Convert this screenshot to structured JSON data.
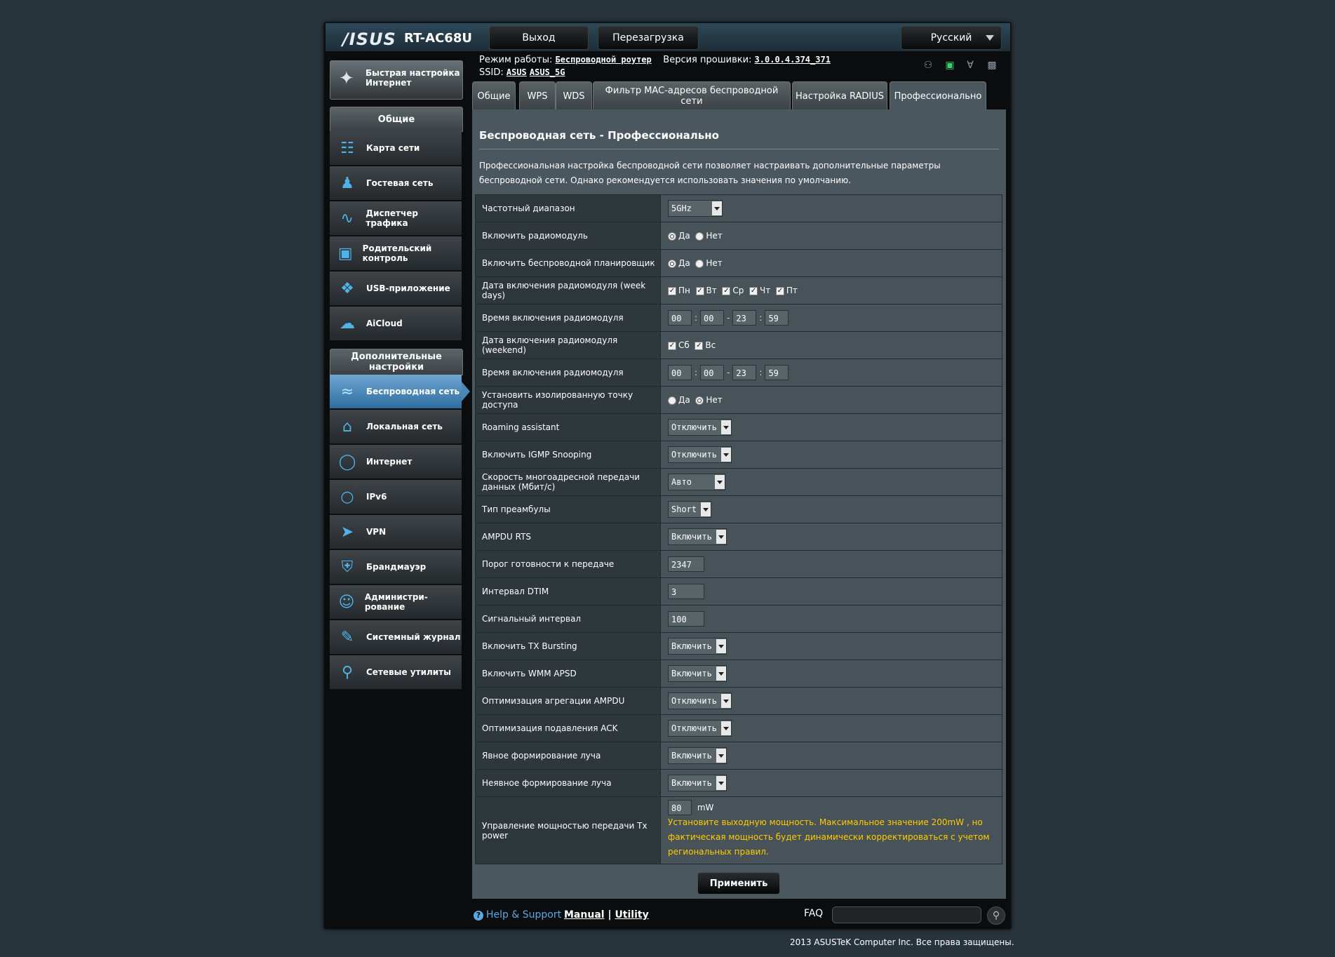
{
  "header": {
    "logo": "/ISUS",
    "model": "RT-AC68U",
    "logout": "Выход",
    "reboot": "Перезагрузка",
    "language": "Русский"
  },
  "status": {
    "mode_label": "Режим работы:",
    "mode_value": "Беспроводной роутер",
    "firmware_label": "Версия прошивки:",
    "firmware_value": "3.0.0.4.374_371",
    "ssid_label": "SSID:",
    "ssid1": "ASUS",
    "ssid2": "ASUS_5G"
  },
  "sidebar": {
    "quick_setup": "Быстрая настройка Интернет",
    "group_general": "Общие",
    "general_items": [
      {
        "label": "Карта сети",
        "icon": "network-map-icon"
      },
      {
        "label": "Гостевая сеть",
        "icon": "guest-network-icon"
      },
      {
        "label": "Диспетчер трафика",
        "icon": "traffic-manager-icon"
      },
      {
        "label": "Родительский контроль",
        "icon": "parental-control-icon"
      },
      {
        "label": "USB-приложение",
        "icon": "usb-app-icon"
      },
      {
        "label": "AiCloud",
        "icon": "aicloud-icon"
      }
    ],
    "group_advanced": "Дополнительные настройки",
    "advanced_items": [
      {
        "label": "Беспроводная сеть",
        "icon": "wireless-icon"
      },
      {
        "label": "Локальная сеть",
        "icon": "lan-icon"
      },
      {
        "label": "Интернет",
        "icon": "globe-icon"
      },
      {
        "label": "IPv6",
        "icon": "ipv6-icon"
      },
      {
        "label": "VPN",
        "icon": "vpn-icon"
      },
      {
        "label": "Брандмауэр",
        "icon": "firewall-icon"
      },
      {
        "label": "Администри-рование",
        "icon": "admin-icon"
      },
      {
        "label": "Системный журнал",
        "icon": "system-log-icon"
      },
      {
        "label": "Сетевые утилиты",
        "icon": "network-tools-icon"
      }
    ]
  },
  "tabs": [
    "Общие",
    "WPS",
    "WDS",
    "Фильтр MAC-адресов беспроводной сети",
    "Настройка RADIUS",
    "Профессионально"
  ],
  "page": {
    "title": "Беспроводная сеть - Профессионально",
    "description": "Профессиональная настройка беспроводной сети позволяет настраивать дополнительные параметры беспроводной сети. Однако рекомендуется использовать значения по умолчанию."
  },
  "labels": {
    "yes": "Да",
    "no": "Нет",
    "mon": "Пн",
    "tue": "Вт",
    "wed": "Ср",
    "thu": "Чт",
    "fri": "Пт",
    "sat": "Сб",
    "sun": "Вс",
    "mw": "mW"
  },
  "settings": {
    "band": {
      "label": "Частотный диапазон",
      "value": "5GHz"
    },
    "radio": {
      "label": "Включить радиомодуль"
    },
    "scheduler": {
      "label": "Включить беспроводной планировщик"
    },
    "weekdays": {
      "label": "Дата включения радиомодуля (week days)"
    },
    "weekday_time": {
      "label": "Время включения радиомодуля",
      "h1": "00",
      "m1": "00",
      "h2": "23",
      "m2": "59"
    },
    "weekend": {
      "label": "Дата включения радиомодуля (weekend)"
    },
    "weekend_time": {
      "label": "Время включения радиомодуля",
      "h1": "00",
      "m1": "00",
      "h2": "23",
      "m2": "59"
    },
    "isolation": {
      "label": "Установить изолированную точку доступа"
    },
    "roaming": {
      "label": "Roaming assistant",
      "value": "Отключить"
    },
    "igmp": {
      "label": "Включить IGMP Snooping",
      "value": "Отключить"
    },
    "multicast": {
      "label": "Скорость многоадресной передачи данных (Мбит/с)",
      "value": "Авто"
    },
    "preamble": {
      "label": "Тип преамбулы",
      "value": "Short"
    },
    "ampdu_rts": {
      "label": "AMPDU RTS",
      "value": "Включить"
    },
    "rts_threshold": {
      "label": "Порог готовности к передаче",
      "value": "2347"
    },
    "dtim": {
      "label": "Интервал DTIM",
      "value": "3"
    },
    "beacon": {
      "label": "Сигнальный интервал",
      "value": "100"
    },
    "tx_bursting": {
      "label": "Включить TX Bursting",
      "value": "Включить"
    },
    "wmm_apsd": {
      "label": "Включить WMM APSD",
      "value": "Включить"
    },
    "ampdu_opt": {
      "label": "Оптимизация агрегации AMPDU",
      "value": "Отключить"
    },
    "ack_opt": {
      "label": "Оптимизация подавления ACK",
      "value": "Отключить"
    },
    "explicit_bf": {
      "label": "Явное формирование луча",
      "value": "Включить"
    },
    "implicit_bf": {
      "label": "Неявное формирование луча",
      "value": "Включить"
    },
    "tx_power": {
      "label": "Управление мощностью передачи Tx power",
      "value": "80",
      "warning": "Установите выходную мощность. Максимальное значение 200mW , но фактическая мощность будет динамически корректироваться с учетом региональных правил."
    }
  },
  "apply": "Применить",
  "footer": {
    "help": "Help & Support",
    "manual": "Manual",
    "sep": "|",
    "utility": "Utility",
    "faq": "FAQ",
    "copyright": "2013  ASUSTeK Computer Inc. Все права защищены."
  }
}
